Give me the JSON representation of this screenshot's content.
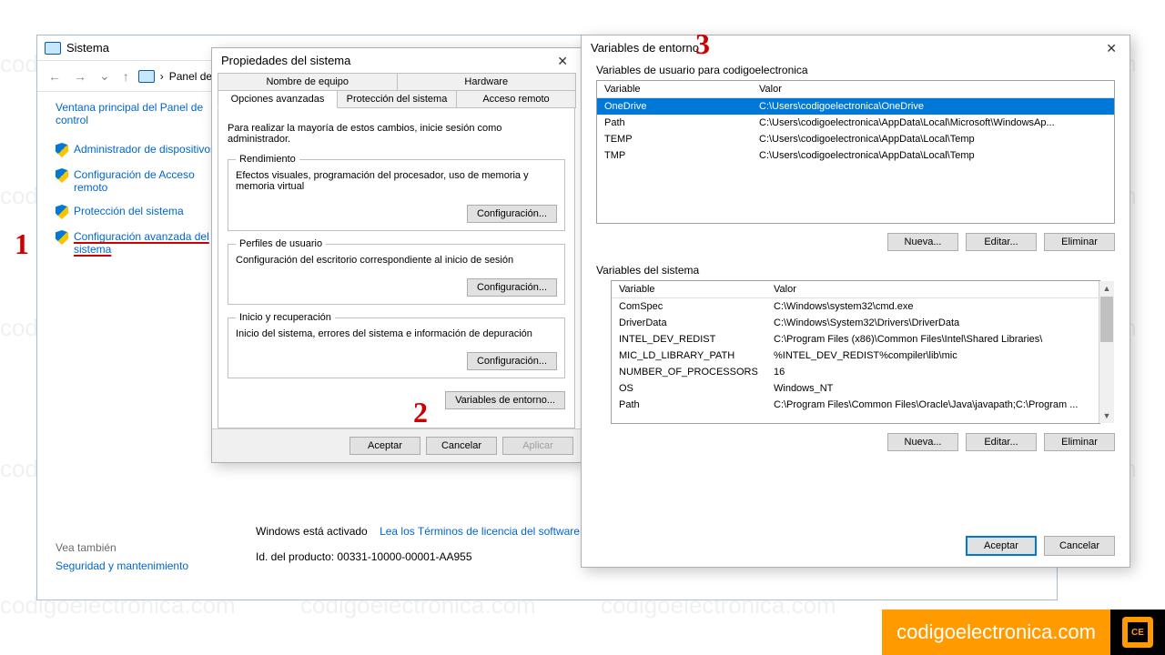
{
  "watermark": "codigoelectronica.com",
  "annotations": {
    "n1": "1",
    "n2": "2",
    "n3": "3"
  },
  "system_window": {
    "title": "Sistema",
    "breadcrumb": "Panel de",
    "side_main": "Ventana principal del Panel de control",
    "side_items": [
      "Administrador de dispositivos",
      "Configuración de Acceso remoto",
      "Protección del sistema",
      "Configuración avanzada del sistema"
    ],
    "activation": "Windows está activado",
    "license_link": "Lea los Términos de licencia del software d",
    "product_id": "Id. del producto: 00331-10000-00001-AA955",
    "see_also": "Vea también",
    "security": "Seguridad y mantenimiento"
  },
  "props_dialog": {
    "title": "Propiedades del sistema",
    "tabs_row1": [
      "Nombre de equipo",
      "Hardware"
    ],
    "tabs_row2": [
      "Opciones avanzadas",
      "Protección del sistema",
      "Acceso remoto"
    ],
    "intro": "Para realizar la mayoría de estos cambios, inicie sesión como administrador.",
    "perf": {
      "legend": "Rendimiento",
      "text": "Efectos visuales, programación del procesador, uso de memoria y memoria virtual",
      "btn": "Configuración..."
    },
    "profiles": {
      "legend": "Perfiles de usuario",
      "text": "Configuración del escritorio correspondiente al inicio de sesión",
      "btn": "Configuración..."
    },
    "startup": {
      "legend": "Inicio y recuperación",
      "text": "Inicio del sistema, errores del sistema e información de depuración",
      "btn": "Configuración..."
    },
    "env_btn": "Variables de entorno...",
    "ok": "Aceptar",
    "cancel": "Cancelar",
    "apply": "Aplicar"
  },
  "env_dialog": {
    "title": "Variables de entorno",
    "user_label": "Variables de usuario para codigoelectronica",
    "col_var": "Variable",
    "col_val": "Valor",
    "user_vars": [
      {
        "name": "OneDrive",
        "value": "C:\\Users\\codigoelectronica\\OneDrive"
      },
      {
        "name": "Path",
        "value": "C:\\Users\\codigoelectronica\\AppData\\Local\\Microsoft\\WindowsAp..."
      },
      {
        "name": "TEMP",
        "value": "C:\\Users\\codigoelectronica\\AppData\\Local\\Temp"
      },
      {
        "name": "TMP",
        "value": "C:\\Users\\codigoelectronica\\AppData\\Local\\Temp"
      }
    ],
    "sys_label": "Variables del sistema",
    "sys_vars": [
      {
        "name": "ComSpec",
        "value": "C:\\Windows\\system32\\cmd.exe"
      },
      {
        "name": "DriverData",
        "value": "C:\\Windows\\System32\\Drivers\\DriverData"
      },
      {
        "name": "INTEL_DEV_REDIST",
        "value": "C:\\Program Files (x86)\\Common Files\\Intel\\Shared Libraries\\"
      },
      {
        "name": "MIC_LD_LIBRARY_PATH",
        "value": "%INTEL_DEV_REDIST%compiler\\lib\\mic"
      },
      {
        "name": "NUMBER_OF_PROCESSORS",
        "value": "16"
      },
      {
        "name": "OS",
        "value": "Windows_NT"
      },
      {
        "name": "Path",
        "value": "C:\\Program Files\\Common Files\\Oracle\\Java\\javapath;C:\\Program ..."
      }
    ],
    "new": "Nueva...",
    "edit": "Editar...",
    "del": "Eliminar",
    "ok": "Aceptar",
    "cancel": "Cancelar"
  },
  "brand": "codigoelectronica.com"
}
